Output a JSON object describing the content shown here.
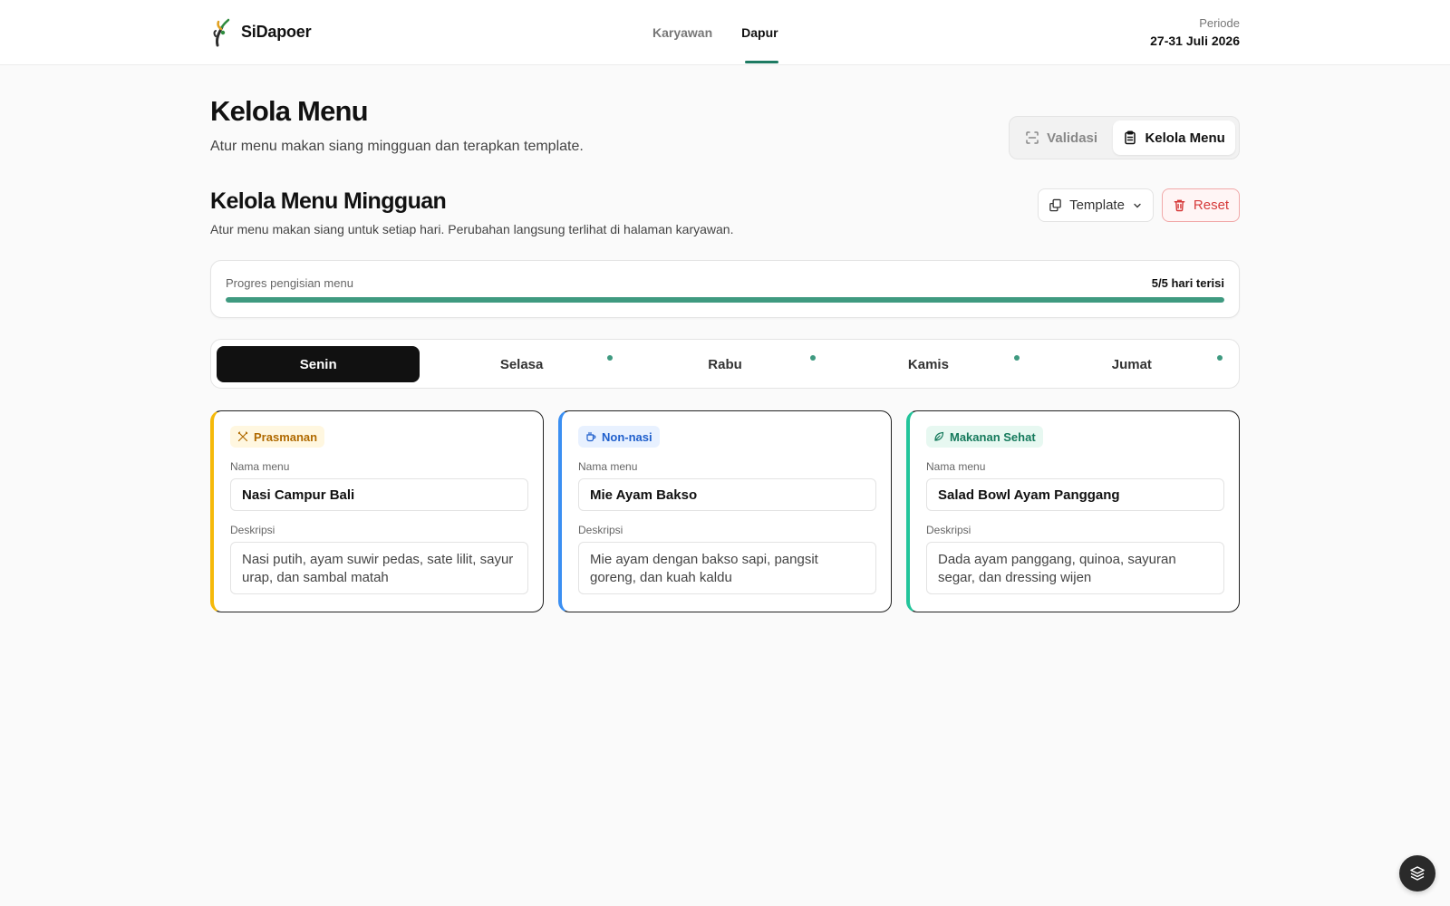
{
  "header": {
    "brand": "SiDapoer",
    "nav": [
      {
        "label": "Karyawan",
        "active": false
      },
      {
        "label": "Dapur",
        "active": true
      }
    ],
    "period_label": "Periode",
    "period_value": "27-31 Juli 2026"
  },
  "page": {
    "title": "Kelola Menu",
    "subtitle": "Atur menu makan siang mingguan dan terapkan template.",
    "segments": [
      "Validasi",
      "Kelola Menu"
    ],
    "active_segment": "Kelola Menu"
  },
  "section": {
    "title": "Kelola Menu Mingguan",
    "subtitle": "Atur menu makan siang untuk setiap hari. Perubahan langsung terlihat di halaman karyawan.",
    "template_label": "Template",
    "reset_label": "Reset"
  },
  "progress": {
    "label": "Progres pengisian menu",
    "count": "5/5 hari terisi",
    "fraction": 1.0
  },
  "days": [
    {
      "label": "Senin",
      "active": true,
      "filled_dot": false
    },
    {
      "label": "Selasa",
      "active": false,
      "filled_dot": true
    },
    {
      "label": "Rabu",
      "active": false,
      "filled_dot": true
    },
    {
      "label": "Kamis",
      "active": false,
      "filled_dot": true
    },
    {
      "label": "Jumat",
      "active": false,
      "filled_dot": true
    }
  ],
  "cards": [
    {
      "badge": "Prasmanan",
      "name_label": "Nama menu",
      "name_value": "Nasi Campur Bali",
      "desc_label": "Deskripsi",
      "desc_value": "Nasi putih, ayam suwir pedas, sate lilit, sayur urap, dan sambal matah"
    },
    {
      "badge": "Non-nasi",
      "name_label": "Nama menu",
      "name_value": "Mie Ayam Bakso",
      "desc_label": "Deskripsi",
      "desc_value": "Mie ayam dengan bakso sapi, pangsit goreng, dan kuah kaldu"
    },
    {
      "badge": "Makanan Sehat",
      "name_label": "Nama menu",
      "name_value": "Salad Bowl Ayam Panggang",
      "desc_label": "Deskripsi",
      "desc_value": "Dada ayam panggang, quinoa, sayuran segar, dan dressing wijen"
    }
  ],
  "colors": {
    "accent": "#1d7a62",
    "progress": "#3f9a80",
    "prasmanan": "#f5b90a",
    "non_nasi": "#3b8ff2",
    "sehat": "#22c49a",
    "reset": "#d63a3a"
  },
  "icons": {
    "segment_validasi": "scan-icon",
    "segment_kelola": "clipboard-icon",
    "template": "copy-icon",
    "reset": "trash-icon",
    "prasmanan": "utensils-crossed-icon",
    "non_nasi": "cup-icon",
    "sehat": "leaf-icon",
    "fab": "layers-icon"
  }
}
